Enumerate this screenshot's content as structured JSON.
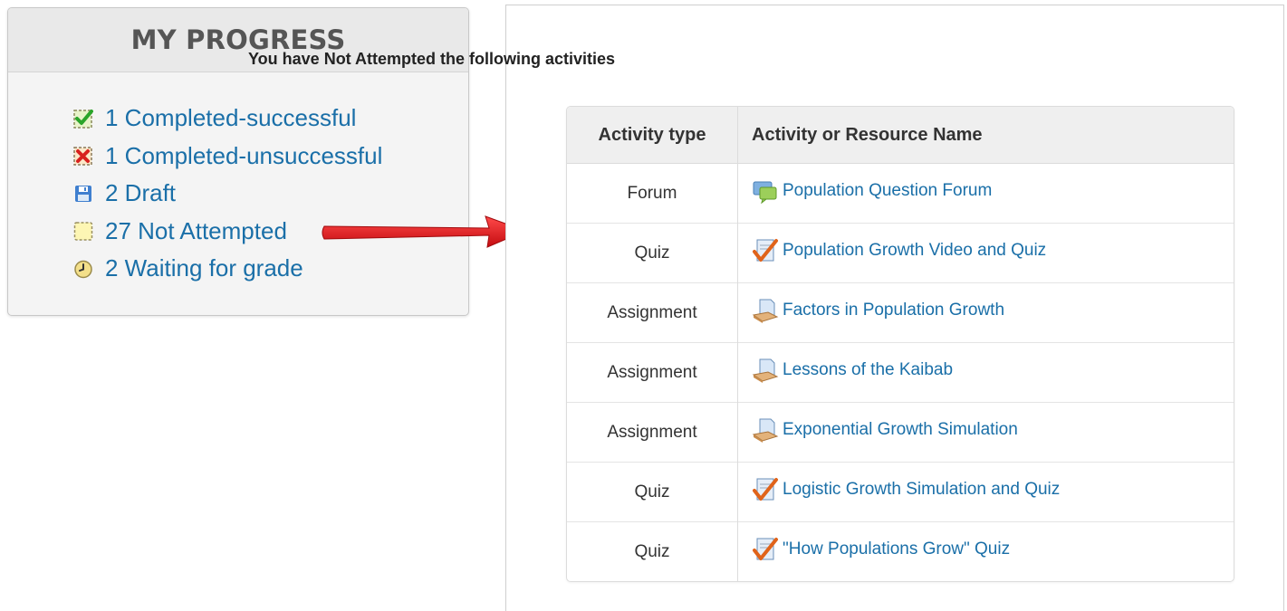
{
  "progress": {
    "title": "MY PROGRESS",
    "items": [
      {
        "label": "1 Completed-successful",
        "icon": "check-icon"
      },
      {
        "label": "1 Completed-unsuccessful",
        "icon": "cross-icon"
      },
      {
        "label": "2 Draft",
        "icon": "floppy-disk-icon"
      },
      {
        "label": "27 Not Attempted",
        "icon": "empty-box-icon"
      },
      {
        "label": "2 Waiting for grade",
        "icon": "clock-icon"
      }
    ]
  },
  "report": {
    "heading": "You have Not Attempted the following activities",
    "columns": [
      "Activity type",
      "Activity or Resource Name"
    ],
    "rows": [
      {
        "type": "Forum",
        "name": "Population Question Forum",
        "icon": "forum-icon"
      },
      {
        "type": "Quiz",
        "name": "Population Growth Video and Quiz",
        "icon": "quiz-icon"
      },
      {
        "type": "Assignment",
        "name": "Factors in Population Growth",
        "icon": "assignment-icon"
      },
      {
        "type": "Assignment",
        "name": "Lessons of the Kaibab",
        "icon": "assignment-icon"
      },
      {
        "type": "Assignment",
        "name": "Exponential Growth Simulation",
        "icon": "assignment-icon"
      },
      {
        "type": "Quiz",
        "name": "Logistic Growth Simulation and Quiz",
        "icon": "quiz-icon"
      },
      {
        "type": "Quiz",
        "name": "\"How Populations Grow\" Quiz",
        "icon": "quiz-icon"
      }
    ]
  },
  "colors": {
    "link": "#1a6fa8",
    "arrow": "#e0161b",
    "header_bg": "#e9e9e9"
  }
}
